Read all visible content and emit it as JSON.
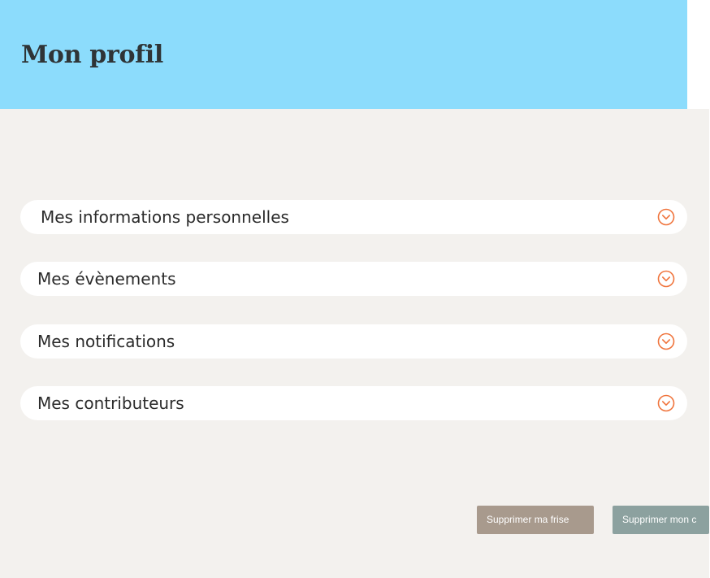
{
  "header": {
    "title": "Mon profil",
    "background_color": "#8cdcfc"
  },
  "accordion": {
    "items": [
      {
        "label": "Mes informations personnelles",
        "icon": "chevron-down-circle-icon"
      },
      {
        "label": "Mes évènements",
        "icon": "chevron-down-circle-icon"
      },
      {
        "label": "Mes notifications",
        "icon": "chevron-down-circle-icon"
      },
      {
        "label": "Mes contributeurs",
        "icon": "chevron-down-circle-icon"
      }
    ],
    "accent_color": "#f0743c"
  },
  "actions": {
    "delete_frise_label": "Supprimer ma frise",
    "delete_account_label": "Supprimer mon c"
  },
  "colors": {
    "content_background": "#f3f1ee",
    "delete_frise_button": "#a89a8d",
    "delete_account_button": "#8ca19f"
  }
}
